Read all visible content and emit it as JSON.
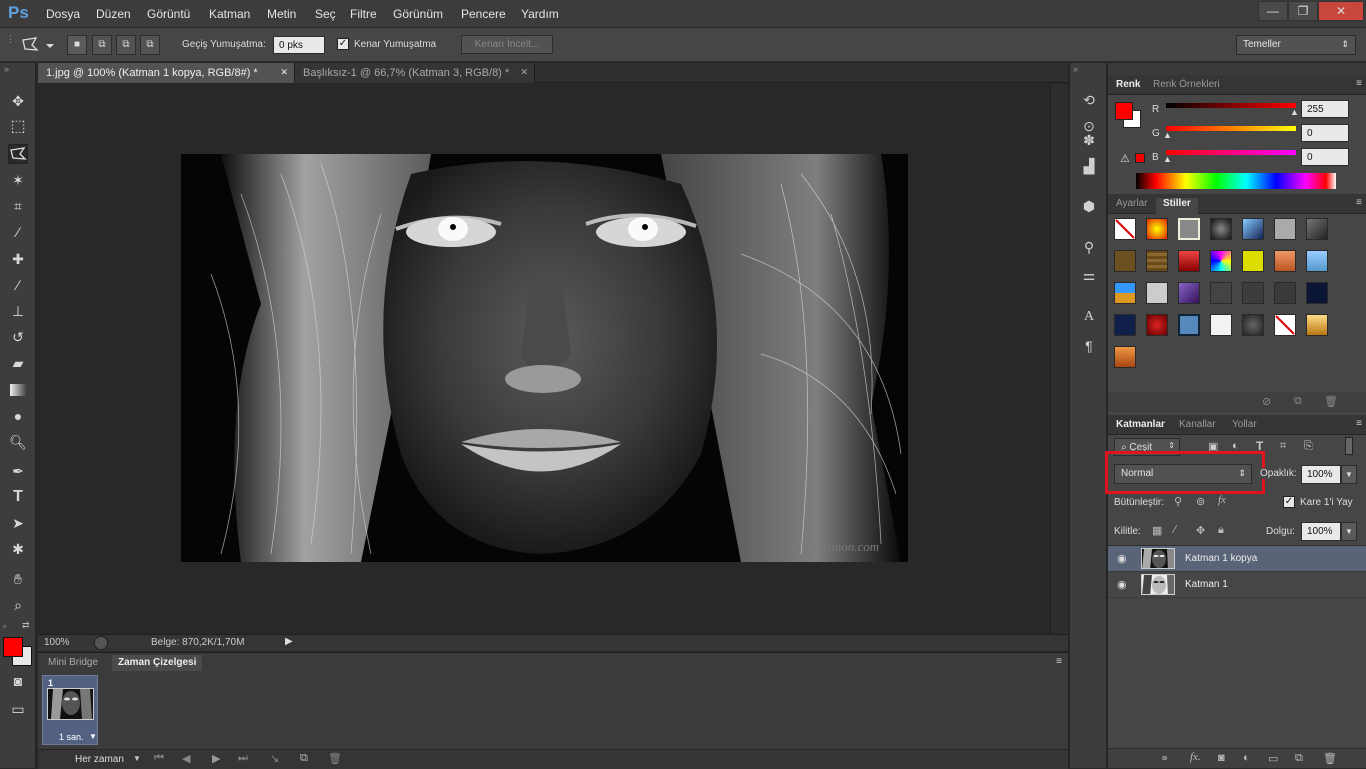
{
  "app": {
    "logo": "Ps"
  },
  "menu": [
    "Dosya",
    "Düzen",
    "Görüntü",
    "Katman",
    "Metin",
    "Seç",
    "Filtre",
    "Görünüm",
    "Pencere",
    "Yardım"
  ],
  "window_controls": {
    "minimize": "—",
    "restore": "❐",
    "close": "✕"
  },
  "options": {
    "feather_label": "Geçiş Yumuşatma:",
    "feather_value": "0 pks",
    "antialias_label": "Kenar Yumuşatma",
    "refine_label": "Kenarı İncelt...",
    "workspace": "Temeller"
  },
  "doc_tabs": [
    {
      "label": "1.jpg @ 100% (Katman 1 kopya, RGB/8#) *",
      "close": "✕"
    },
    {
      "label": "Başlıksız-1 @ 66,7% (Katman 3, RGB/8) *",
      "close": "✕"
    }
  ],
  "status": {
    "zoom": "100%",
    "doc": "Belge: 870,2K/1,70M"
  },
  "photo": {
    "watermark": "Sirke Limon.com"
  },
  "timeline": {
    "tabs": [
      "Mini Bridge",
      "Zaman Çizelgesi"
    ],
    "frame_number": "1",
    "frame_delay": "1 san.",
    "loop": "Her zaman"
  },
  "color_panel": {
    "tabs": [
      "Renk",
      "Renk Örnekleri"
    ],
    "r_label": "R",
    "g_label": "G",
    "b_label": "B",
    "r": "255",
    "g": "0",
    "b": "0",
    "foreground": "#ff0000"
  },
  "styles_panel": {
    "tabs": [
      "Ayarlar",
      "Stiller"
    ]
  },
  "layers_panel": {
    "tabs": [
      "Katmanlar",
      "Kanallar",
      "Yollar"
    ],
    "filter": "Çeşit",
    "blend_mode": "Normal",
    "opacity_label": "Opaklık:",
    "opacity": "100%",
    "unify_label": "Bütünleştir:",
    "propagate_label": "Kare 1'i Yay",
    "lock_label": "Kilitle:",
    "fill_label": "Dolgu:",
    "fill": "100%",
    "layers": [
      {
        "name": "Katman 1 kopya",
        "selected": true
      },
      {
        "name": "Katman 1",
        "selected": false
      }
    ]
  },
  "highlight_color": "#e0141e"
}
